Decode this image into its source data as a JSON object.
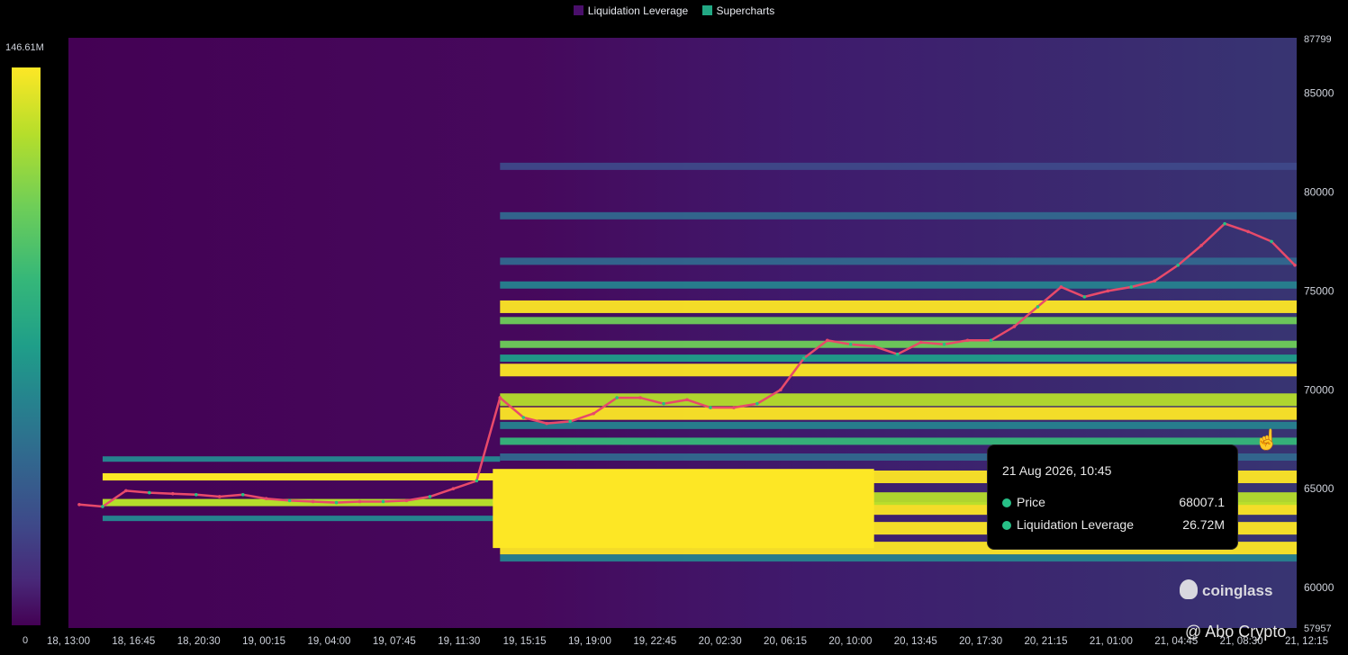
{
  "legend": [
    {
      "label": "Liquidation Leverage",
      "color": "#4a0f6b"
    },
    {
      "label": "Supercharts",
      "color": "#22a884"
    }
  ],
  "colorbar": {
    "max_label": "146.61M",
    "min_label": "0"
  },
  "chart_data": {
    "type": "heatmap",
    "title": "",
    "xlabel": "",
    "ylabel": "",
    "x_ticks": [
      "18, 13:00",
      "18, 16:45",
      "18, 20:30",
      "19, 00:15",
      "19, 04:00",
      "19, 07:45",
      "19, 11:30",
      "19, 15:15",
      "19, 19:00",
      "19, 22:45",
      "20, 02:30",
      "20, 06:15",
      "20, 10:00",
      "20, 13:45",
      "20, 17:30",
      "20, 21:15",
      "21, 01:00",
      "21, 04:45",
      "21, 08:30",
      "21, 12:15"
    ],
    "y_ticks": [
      60000,
      65000,
      70000,
      75000,
      80000,
      85000
    ],
    "y_axis_top_label": "87799",
    "y_axis_bottom_label": "57957",
    "ylim": [
      57957,
      87799
    ],
    "price_series": {
      "name": "Price",
      "values": [
        64200,
        64100,
        64900,
        64800,
        64750,
        64700,
        64600,
        64700,
        64500,
        64400,
        64350,
        64300,
        64350,
        64350,
        64400,
        64600,
        65000,
        65400,
        69600,
        68600,
        68300,
        68400,
        68800,
        69600,
        69600,
        69300,
        69500,
        69100,
        69100,
        69300,
        70000,
        71600,
        72500,
        72300,
        72200,
        71800,
        72400,
        72300,
        72500,
        72500,
        73200,
        74200,
        75200,
        74700,
        75000,
        75200,
        75500,
        76300,
        77300,
        78400,
        78000,
        77500,
        76300
      ]
    },
    "heat_bands": [
      {
        "price": 61500,
        "level": 0.45
      },
      {
        "price": 62000,
        "level": 1.0
      },
      {
        "price": 63000,
        "level": 1.0
      },
      {
        "price": 64000,
        "level": 1.0
      },
      {
        "price": 64500,
        "level": 0.9
      },
      {
        "price": 65600,
        "level": 1.0
      },
      {
        "price": 66600,
        "level": 0.35
      },
      {
        "price": 67400,
        "level": 0.65
      },
      {
        "price": 68200,
        "level": 0.45
      },
      {
        "price": 68800,
        "level": 0.95
      },
      {
        "price": 69500,
        "level": 0.9
      },
      {
        "price": 71000,
        "level": 0.95
      },
      {
        "price": 71600,
        "level": 0.5
      },
      {
        "price": 72300,
        "level": 0.8
      },
      {
        "price": 73500,
        "level": 0.8
      },
      {
        "price": 74200,
        "level": 0.95
      },
      {
        "price": 75300,
        "level": 0.4
      },
      {
        "price": 76500,
        "level": 0.35
      },
      {
        "price": 78800,
        "level": 0.3
      },
      {
        "price": 81300,
        "level": 0.25
      }
    ],
    "colorscale": "viridis"
  },
  "tooltip": {
    "title": "21 Aug 2026, 10:45",
    "rows": [
      {
        "label": "Price",
        "value": "68007.1"
      },
      {
        "label": "Liquidation Leverage",
        "value": "26.72M"
      }
    ]
  },
  "watermark": "coinglass",
  "credit": "@ Abo Crypto"
}
